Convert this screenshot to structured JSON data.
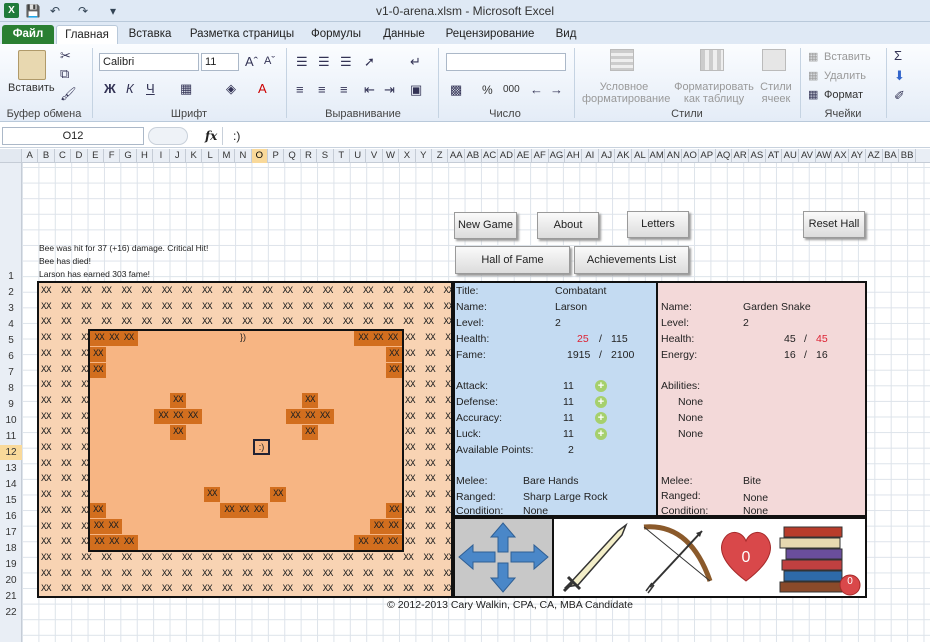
{
  "window": {
    "title": "v1-0-arena.xlsm - Microsoft Excel"
  },
  "quick_access": [
    "save-icon",
    "undo-icon",
    "redo-icon",
    "customize-icon"
  ],
  "tabs": [
    "Файл",
    "Главная",
    "Вставка",
    "Разметка страницы",
    "Формулы",
    "Данные",
    "Рецензирование",
    "Вид"
  ],
  "ribbon": {
    "clipboard": {
      "paste": "Вставить",
      "group": "Буфер обмена"
    },
    "font": {
      "name": "Calibri",
      "size": "11",
      "group": "Шрифт",
      "bold": "Ж",
      "italic": "К",
      "underline": "Ч"
    },
    "alignment": {
      "group": "Выравнивание"
    },
    "number": {
      "group": "Число",
      "percent": "%",
      "thousands": "000"
    },
    "styles": {
      "conditional": "Условное форматирование",
      "table": "Форматировать как таблицу",
      "cell_styles": "Стили ячеек",
      "group": "Стили"
    },
    "cells": {
      "insert": "Вставить",
      "delete": "Удалить",
      "format": "Формат",
      "group": "Ячейки"
    }
  },
  "formula_bar": {
    "name_box": "O12",
    "fx": "fx",
    "value": ":)"
  },
  "columns": [
    "A",
    "B",
    "C",
    "D",
    "E",
    "F",
    "G",
    "H",
    "I",
    "J",
    "K",
    "L",
    "M",
    "N",
    "O",
    "P",
    "Q",
    "R",
    "S",
    "T",
    "U",
    "V",
    "W",
    "X",
    "Y",
    "Z",
    "AA",
    "AB",
    "AC",
    "AD",
    "AE",
    "AF",
    "AG",
    "AH",
    "AI",
    "AJ",
    "AK",
    "AL",
    "AM",
    "AN",
    "AO",
    "AP",
    "AQ",
    "AR",
    "AS",
    "AT",
    "AU",
    "AV",
    "AW",
    "AX",
    "AY",
    "AZ",
    "BA",
    "BB"
  ],
  "selected_column": "O",
  "rows": [
    "1",
    "2",
    "3",
    "4",
    "5",
    "6",
    "7",
    "8",
    "9",
    "10",
    "11",
    "12",
    "13",
    "14",
    "15",
    "16",
    "17",
    "18",
    "19",
    "20",
    "21",
    "22"
  ],
  "selected_row": "12",
  "buttons": {
    "new_game": "New Game",
    "about": "About",
    "letters": "Letters",
    "reset_hall": "Reset Hall",
    "hall_of_fame": "Hall of Fame",
    "achievements": "Achievements List"
  },
  "messages": [
    "Bee was hit for 37 (+16) damage. Critical Hit!",
    "Bee has died!",
    "Larson has earned 303 fame!"
  ],
  "arena": {
    "wall": "XX",
    "player": ":)",
    "item": "})"
  },
  "player": {
    "title_label": "Title:",
    "title": "Combatant",
    "name_label": "Name:",
    "name": "Larson",
    "level_label": "Level:",
    "level": "2",
    "health_label": "Health:",
    "health": "25",
    "health_max": "115",
    "fame_label": "Fame:",
    "fame": "1915",
    "fame_max": "2100",
    "attack_label": "Attack:",
    "attack": "11",
    "defense_label": "Defense:",
    "defense": "11",
    "accuracy_label": "Accuracy:",
    "accuracy": "11",
    "luck_label": "Luck:",
    "luck": "11",
    "points_label": "Available Points:",
    "points": "2",
    "melee_label": "Melee:",
    "melee": "Bare Hands",
    "ranged_label": "Ranged:",
    "ranged": "Sharp Large Rock",
    "condition_label": "Condition:",
    "condition": "None",
    "slash": "/"
  },
  "enemy": {
    "name_label": "Name:",
    "name": "Garden Snake",
    "level_label": "Level:",
    "level": "2",
    "health_label": "Health:",
    "health": "45",
    "health_max": "45",
    "energy_label": "Energy:",
    "energy": "16",
    "energy_max": "16",
    "abilities_label": "Abilities:",
    "abilities": [
      "None",
      "None",
      "None"
    ],
    "melee_label": "Melee:",
    "melee": "Bite",
    "ranged_label": "Ranged:",
    "ranged": "None",
    "condition_label": "Condition:",
    "condition": "None"
  },
  "actions": {
    "potions": "0",
    "books": "0"
  },
  "copyright": "© 2012-2013 Cary Walkin, CPA, CA, MBA Candidate",
  "colors": {
    "file_tab": "#2a7f32",
    "arena_bg": "#f8d3b3",
    "room_bg": "#f7b583",
    "wall": "#d26e1e",
    "player_panel": "#c4dbf2",
    "enemy_panel": "#f3d9d9",
    "dpad": "#4a87c8",
    "heart": "#d9484a"
  }
}
